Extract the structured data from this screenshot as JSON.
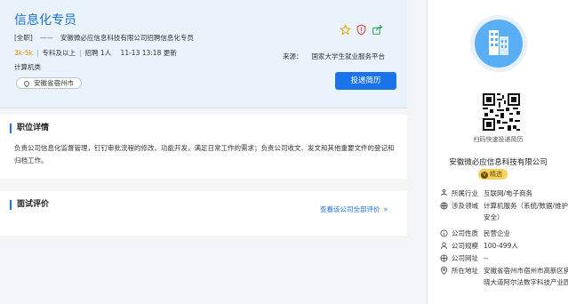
{
  "job": {
    "title": "信息化专员",
    "type_tag": "[全职]",
    "dash": "——",
    "headline": "安徽微必应信息科技有限公司招聘信息化专员",
    "salary": "3k-5k",
    "education": "专科及以上",
    "hiring": "招聘 1人",
    "updated": "11-13 13:18 更新",
    "category": "计算机类",
    "source_label": "来源：",
    "source_value": "国家大学生就业服务平台",
    "location": "安徽省宿州市",
    "apply_label": "投递简历"
  },
  "icons": [
    "star-icon",
    "shield-icon",
    "share-icon"
  ],
  "description": {
    "heading": "职位详情",
    "text": "负责公司信息化监督管理，钉钉审批流程的修改、功能开发，满足日常工作的需求；负责公司收文、发文和其他重要文件的登记和归档工作。"
  },
  "review": {
    "heading": "面试评价",
    "link": "查看该公司全部评价",
    "chevron": "»"
  },
  "company": {
    "qr_caption": "扫码快速投递简历",
    "name": "安徽微必应信息科技有限公司",
    "badge": "精选",
    "badge_mark": "V",
    "rows": [
      {
        "label": "所属行业",
        "value": "互联网/电子商务"
      },
      {
        "label": "涉及领域",
        "value": "计算机服务（系统/数据/维护/安全）"
      },
      {
        "label": "公司性质",
        "value": "民营企业"
      },
      {
        "label": "公司规模",
        "value": "100-499人"
      },
      {
        "label": "公司网址",
        "value": "--"
      },
      {
        "label": "所在地址",
        "value": "安徽省宿州市宿州市高新区拂晓大道阿尔法数字科技产业园"
      }
    ]
  },
  "colors": {
    "accent": "#1a73e8",
    "salary": "#f08a00",
    "badge": "#f6d160"
  }
}
